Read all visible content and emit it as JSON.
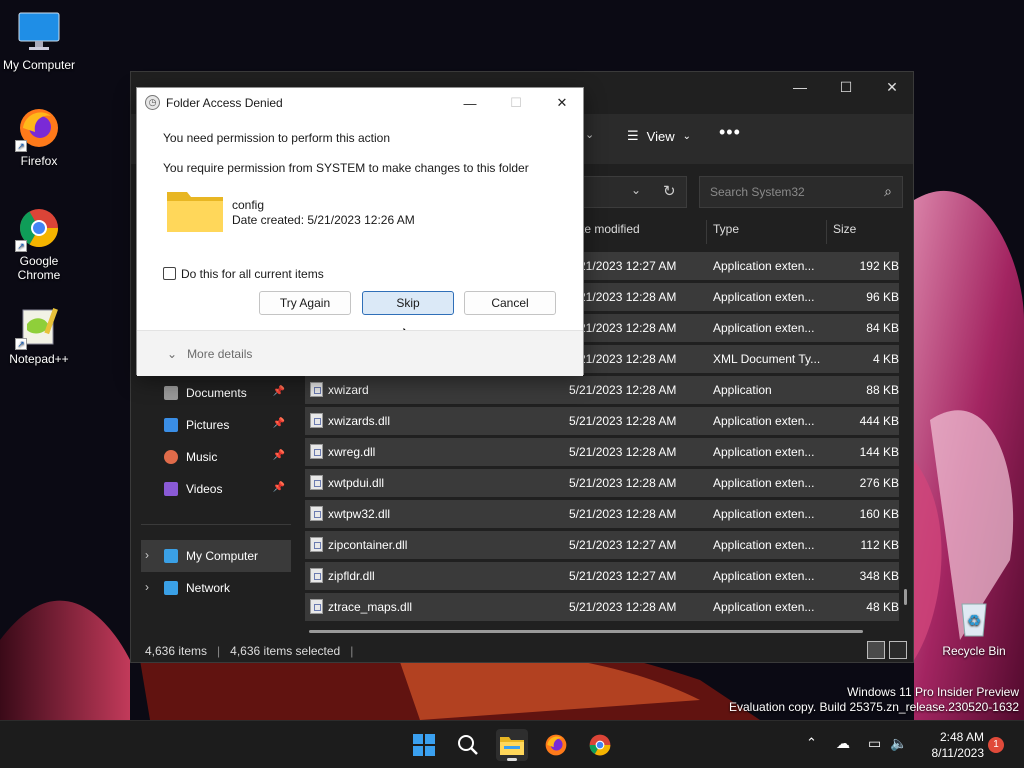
{
  "desktop": {
    "icons": [
      {
        "label": "My Computer"
      },
      {
        "label": "Firefox"
      },
      {
        "label": "Google Chrome"
      },
      {
        "label": "Notepad++"
      },
      {
        "label": "Recycle Bin"
      }
    ],
    "watermark_line1": "Windows 11 Pro Insider Preview",
    "watermark_line2": "Evaluation copy. Build 25375.zn_release.230520-1632"
  },
  "explorer": {
    "toolbar": {
      "view_label": "View",
      "more_label": "•••"
    },
    "search_placeholder": "Search System32",
    "columns": {
      "date": "te modified",
      "type": "Type",
      "size": "Size"
    },
    "files": [
      {
        "name": "",
        "date": "5/21/2023 12:27 AM",
        "type": "Application exten...",
        "size": "192 KB"
      },
      {
        "name": "",
        "date": "5/21/2023 12:28 AM",
        "type": "Application exten...",
        "size": "96 KB"
      },
      {
        "name": "",
        "date": "5/21/2023 12:28 AM",
        "type": "Application exten...",
        "size": "84 KB"
      },
      {
        "name": "",
        "date": "5/21/2023 12:28 AM",
        "type": "XML Document Ty...",
        "size": "4 KB"
      },
      {
        "name": "xwizard",
        "date": "5/21/2023 12:28 AM",
        "type": "Application",
        "size": "88 KB"
      },
      {
        "name": "xwizards.dll",
        "date": "5/21/2023 12:28 AM",
        "type": "Application exten...",
        "size": "444 KB"
      },
      {
        "name": "xwreg.dll",
        "date": "5/21/2023 12:28 AM",
        "type": "Application exten...",
        "size": "144 KB"
      },
      {
        "name": "xwtpdui.dll",
        "date": "5/21/2023 12:28 AM",
        "type": "Application exten...",
        "size": "276 KB"
      },
      {
        "name": "xwtpw32.dll",
        "date": "5/21/2023 12:28 AM",
        "type": "Application exten...",
        "size": "160 KB"
      },
      {
        "name": "zipcontainer.dll",
        "date": "5/21/2023 12:27 AM",
        "type": "Application exten...",
        "size": "112 KB"
      },
      {
        "name": "zipfldr.dll",
        "date": "5/21/2023 12:27 AM",
        "type": "Application exten...",
        "size": "348 KB"
      },
      {
        "name": "ztrace_maps.dll",
        "date": "5/21/2023 12:28 AM",
        "type": "Application exten...",
        "size": "48 KB"
      }
    ],
    "nav": [
      {
        "label": "Documents",
        "color": "#9a9a9a"
      },
      {
        "label": "Pictures",
        "color": "#3a8ee6"
      },
      {
        "label": "Music",
        "color": "#e06b4a"
      },
      {
        "label": "Videos",
        "color": "#8a5ad6"
      },
      {
        "label": "My Computer",
        "color": "#3aa0e6"
      },
      {
        "label": "Network",
        "color": "#3aa0e6"
      }
    ],
    "status": {
      "items": "4,636 items",
      "selected": "4,636 items selected"
    }
  },
  "dialog": {
    "title": "Folder Access Denied",
    "message1": "You need permission to perform this action",
    "message2": "You require permission from SYSTEM to make changes to this folder",
    "folder_name": "config",
    "folder_date": "Date created: 5/21/2023 12:26 AM",
    "checkbox_label": "Do this for all current items",
    "btn_try_again": "Try Again",
    "btn_skip": "Skip",
    "btn_cancel": "Cancel",
    "more_details": "More details"
  },
  "taskbar": {
    "time": "2:48 AM",
    "date": "8/11/2023",
    "notification_count": "1"
  },
  "colors": {
    "accent": "#2f6fb8",
    "explorer_bg": "#202020",
    "dialog_bg": "#f3f3f3"
  }
}
